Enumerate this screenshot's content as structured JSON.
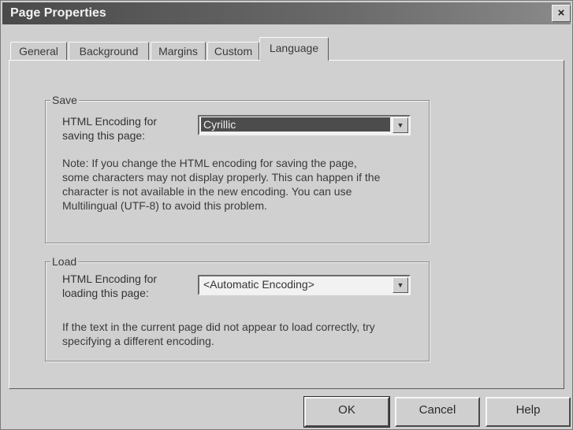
{
  "window": {
    "title": "Page Properties",
    "close_glyph": "×"
  },
  "tabs": [
    {
      "label": "General"
    },
    {
      "label": "Background"
    },
    {
      "label": "Margins"
    },
    {
      "label": "Custom"
    },
    {
      "label": "Language"
    }
  ],
  "active_tab": "Language",
  "save_group": {
    "legend": "Save",
    "label_line1": "HTML Encoding for",
    "label_line2": "saving this page:",
    "selected": "Cyrillic",
    "note_lines": [
      "Note: If you change the HTML encoding for saving the page,",
      "some characters may not display properly.  This can happen if the",
      "character is not available in the new encoding.  You can use",
      "Multilingual (UTF-8) to avoid this problem."
    ]
  },
  "load_group": {
    "legend": "Load",
    "label_line1": "HTML Encoding for",
    "label_line2": "loading this page:",
    "selected": "<Automatic Encoding>",
    "note_lines": [
      "If the text in the current page did not appear to load correctly, try",
      "specifying a different encoding."
    ]
  },
  "buttons": {
    "ok": "OK",
    "cancel": "Cancel",
    "help": "Help"
  },
  "icons": {
    "dropdown": "chevron-down-icon",
    "close": "close-icon"
  }
}
